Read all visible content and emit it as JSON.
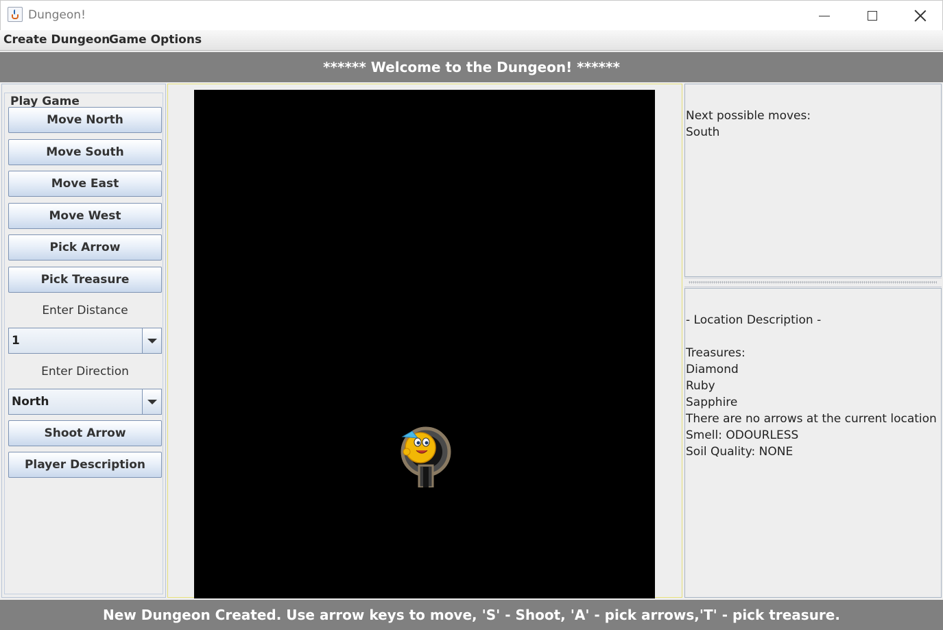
{
  "window": {
    "title": "Dungeon!"
  },
  "menu": {
    "items": [
      "Create Dungeon",
      "Game Options"
    ]
  },
  "header": {
    "banner": "****** Welcome to the Dungeon! ******"
  },
  "controls": {
    "group_title": "Play Game",
    "buttons": {
      "move_north": "Move North",
      "move_south": "Move South",
      "move_east": "Move East",
      "move_west": "Move West",
      "pick_arrow": "Pick Arrow",
      "pick_treasure": "Pick Treasure",
      "shoot_arrow": "Shoot Arrow",
      "player_description": "Player Description"
    },
    "distance_label": "Enter Distance",
    "distance_value": "1",
    "direction_label": "Enter Direction",
    "direction_value": "North"
  },
  "moves": {
    "heading": "Next possible moves:",
    "list": [
      "South"
    ]
  },
  "location": {
    "heading": " - Location Description -",
    "treasures_label": "Treasures:",
    "treasures": [
      "Diamond",
      "Ruby",
      "Sapphire"
    ],
    "arrows_text": "There are no arrows at the current location",
    "smell": "Smell: ODOURLESS",
    "soil": "Soil Quality: NONE"
  },
  "status": {
    "message": "New Dungeon Created. Use arrow keys to move, 'S' - Shoot, 'A' - pick arrows,'T' - pick treasure."
  },
  "colors": {
    "banner_bg": "#808080",
    "maze_bg": "#000000",
    "button_border": "#7d93b3"
  }
}
